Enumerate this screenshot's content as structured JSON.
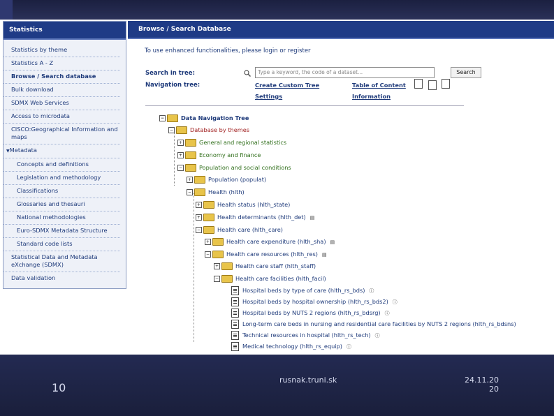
{
  "sidebar": {
    "title": "Statistics",
    "items": [
      {
        "label": "Statistics by theme"
      },
      {
        "label": "Statistics A - Z"
      },
      {
        "label": "Browse / Search database"
      },
      {
        "label": "Bulk download"
      },
      {
        "label": "SDMX Web Services"
      },
      {
        "label": "Access to microdata"
      },
      {
        "label": "CISCO:Geographical Information and maps"
      },
      {
        "label": "Metadata"
      },
      {
        "label": "Concepts and definitions"
      },
      {
        "label": "Legislation and methodology"
      },
      {
        "label": "Classifications"
      },
      {
        "label": "Glossaries and thesauri"
      },
      {
        "label": "National methodologies"
      },
      {
        "label": "Euro-SDMX Metadata Structure"
      },
      {
        "label": "Standard code lists"
      },
      {
        "label": "Statistical Data and Metadata eXchange (SDMX)"
      },
      {
        "label": "Data validation"
      }
    ]
  },
  "main": {
    "title": "Browse / Search Database",
    "login_text": "To use enhanced functionalities, please login or register",
    "search_label": "Search in tree:",
    "search_placeholder": "Type a keyword, the code of a dataset...",
    "search_button": "Search",
    "nav_label": "Navigation tree:",
    "create_tree": "Create Custom Tree",
    "settings": "Settings",
    "toc": "Table of Content",
    "information": "Information"
  },
  "tree": {
    "root": "Data Navigation Tree",
    "by_themes": "Database by themes",
    "general": "General and regional statistics",
    "economy": "Economy and finance",
    "population_social": "Population and social conditions",
    "population": "Population (populat)",
    "health": "Health (hlth)",
    "health_status": "Health status (hlth_state)",
    "health_det": "Health determinants (hlth_det)",
    "health_care": "Health care (hlth_care)",
    "hc_exp": "Health care expenditure (hlth_sha)",
    "hc_res": "Health care resources (hlth_res)",
    "hc_staff": "Health care staff (hlth_staff)",
    "hc_fac": "Health care facilities (hlth_facil)",
    "t1": "Hospital beds by type of care (hlth_rs_bds)",
    "t2": "Hospital beds by hospital ownership (hlth_rs_bds2)",
    "t3": "Hospital beds by NUTS 2 regions (hlth_rs_bdsrg)",
    "t4": "Long-term care beds in nursing and residential care facilities by NUTS 2 regions (hlth_rs_bdsns)",
    "t5": "Technical resources in hospital (hlth_rs_tech)",
    "t6": "Medical technology (hlth_rs_equip)"
  },
  "footer": {
    "page": "10",
    "site": "rusnak.truni.sk",
    "date": "24.11.20",
    "year": "20"
  }
}
